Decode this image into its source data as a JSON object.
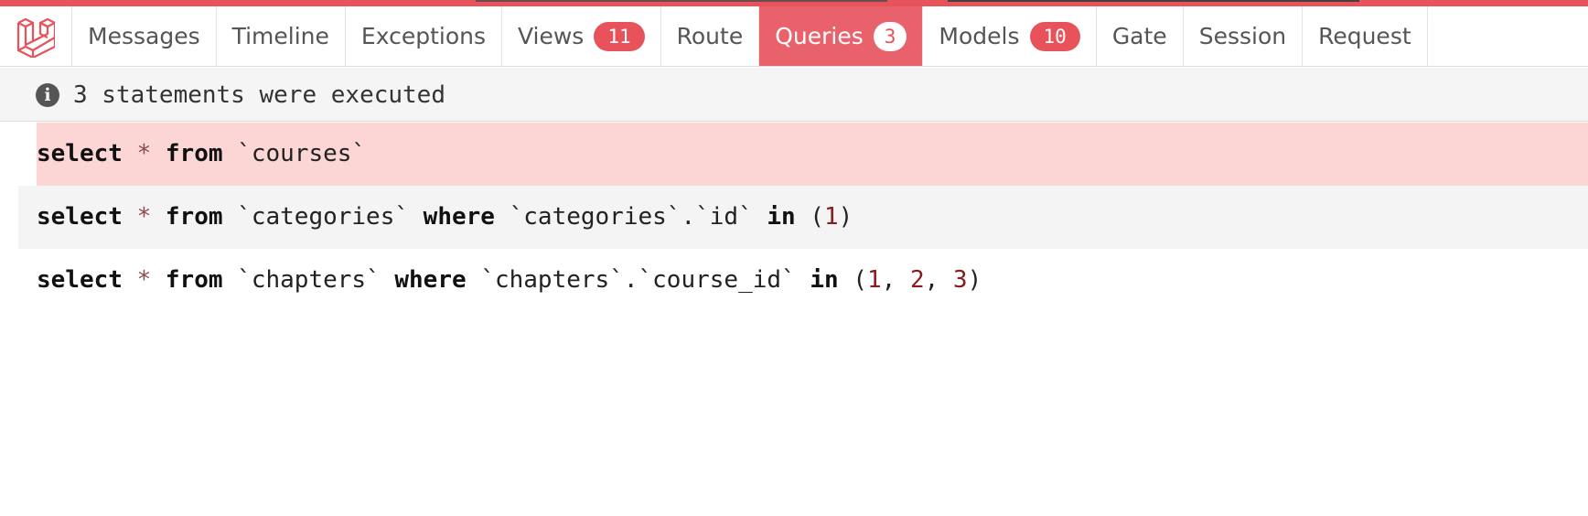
{
  "colors": {
    "accent": "#e7525b",
    "active_tab_bg": "#e9626b",
    "highlight_row": "#fbd6d5",
    "alt_row": "#f4f4f4"
  },
  "logo": {
    "icon": "laravel-logo-icon"
  },
  "tabs": [
    {
      "label": "Messages"
    },
    {
      "label": "Timeline"
    },
    {
      "label": "Exceptions"
    },
    {
      "label": "Views",
      "badge": "11"
    },
    {
      "label": "Route"
    },
    {
      "label": "Queries",
      "badge": "3",
      "active": true
    },
    {
      "label": "Models",
      "badge": "10"
    },
    {
      "label": "Gate"
    },
    {
      "label": "Session"
    },
    {
      "label": "Request"
    }
  ],
  "info": {
    "icon": "info-icon",
    "glyph": "i",
    "text": "3 statements were executed"
  },
  "queries": [
    {
      "tokens": [
        {
          "t": "kw",
          "v": "select"
        },
        {
          "t": "sp",
          "v": " "
        },
        {
          "t": "op",
          "v": "*"
        },
        {
          "t": "sp",
          "v": " "
        },
        {
          "t": "kw",
          "v": "from"
        },
        {
          "t": "sp",
          "v": " "
        },
        {
          "t": "id",
          "v": "`courses`"
        }
      ]
    },
    {
      "tokens": [
        {
          "t": "kw",
          "v": "select"
        },
        {
          "t": "sp",
          "v": " "
        },
        {
          "t": "op",
          "v": "*"
        },
        {
          "t": "sp",
          "v": " "
        },
        {
          "t": "kw",
          "v": "from"
        },
        {
          "t": "sp",
          "v": " "
        },
        {
          "t": "id",
          "v": "`categories`"
        },
        {
          "t": "sp",
          "v": " "
        },
        {
          "t": "kw",
          "v": "where"
        },
        {
          "t": "sp",
          "v": " "
        },
        {
          "t": "id",
          "v": "`categories`.`id`"
        },
        {
          "t": "sp",
          "v": " "
        },
        {
          "t": "kw",
          "v": "in"
        },
        {
          "t": "sp",
          "v": " "
        },
        {
          "t": "id",
          "v": "("
        },
        {
          "t": "num",
          "v": "1"
        },
        {
          "t": "id",
          "v": ")"
        }
      ]
    },
    {
      "tokens": [
        {
          "t": "kw",
          "v": "select"
        },
        {
          "t": "sp",
          "v": " "
        },
        {
          "t": "op",
          "v": "*"
        },
        {
          "t": "sp",
          "v": " "
        },
        {
          "t": "kw",
          "v": "from"
        },
        {
          "t": "sp",
          "v": " "
        },
        {
          "t": "id",
          "v": "`chapters`"
        },
        {
          "t": "sp",
          "v": " "
        },
        {
          "t": "kw",
          "v": "where"
        },
        {
          "t": "sp",
          "v": " "
        },
        {
          "t": "id",
          "v": "`chapters`.`course_id`"
        },
        {
          "t": "sp",
          "v": " "
        },
        {
          "t": "kw",
          "v": "in"
        },
        {
          "t": "sp",
          "v": " "
        },
        {
          "t": "id",
          "v": "("
        },
        {
          "t": "num",
          "v": "1"
        },
        {
          "t": "id",
          "v": ", "
        },
        {
          "t": "num",
          "v": "2"
        },
        {
          "t": "id",
          "v": ", "
        },
        {
          "t": "num",
          "v": "3"
        },
        {
          "t": "id",
          "v": ")"
        }
      ]
    }
  ]
}
